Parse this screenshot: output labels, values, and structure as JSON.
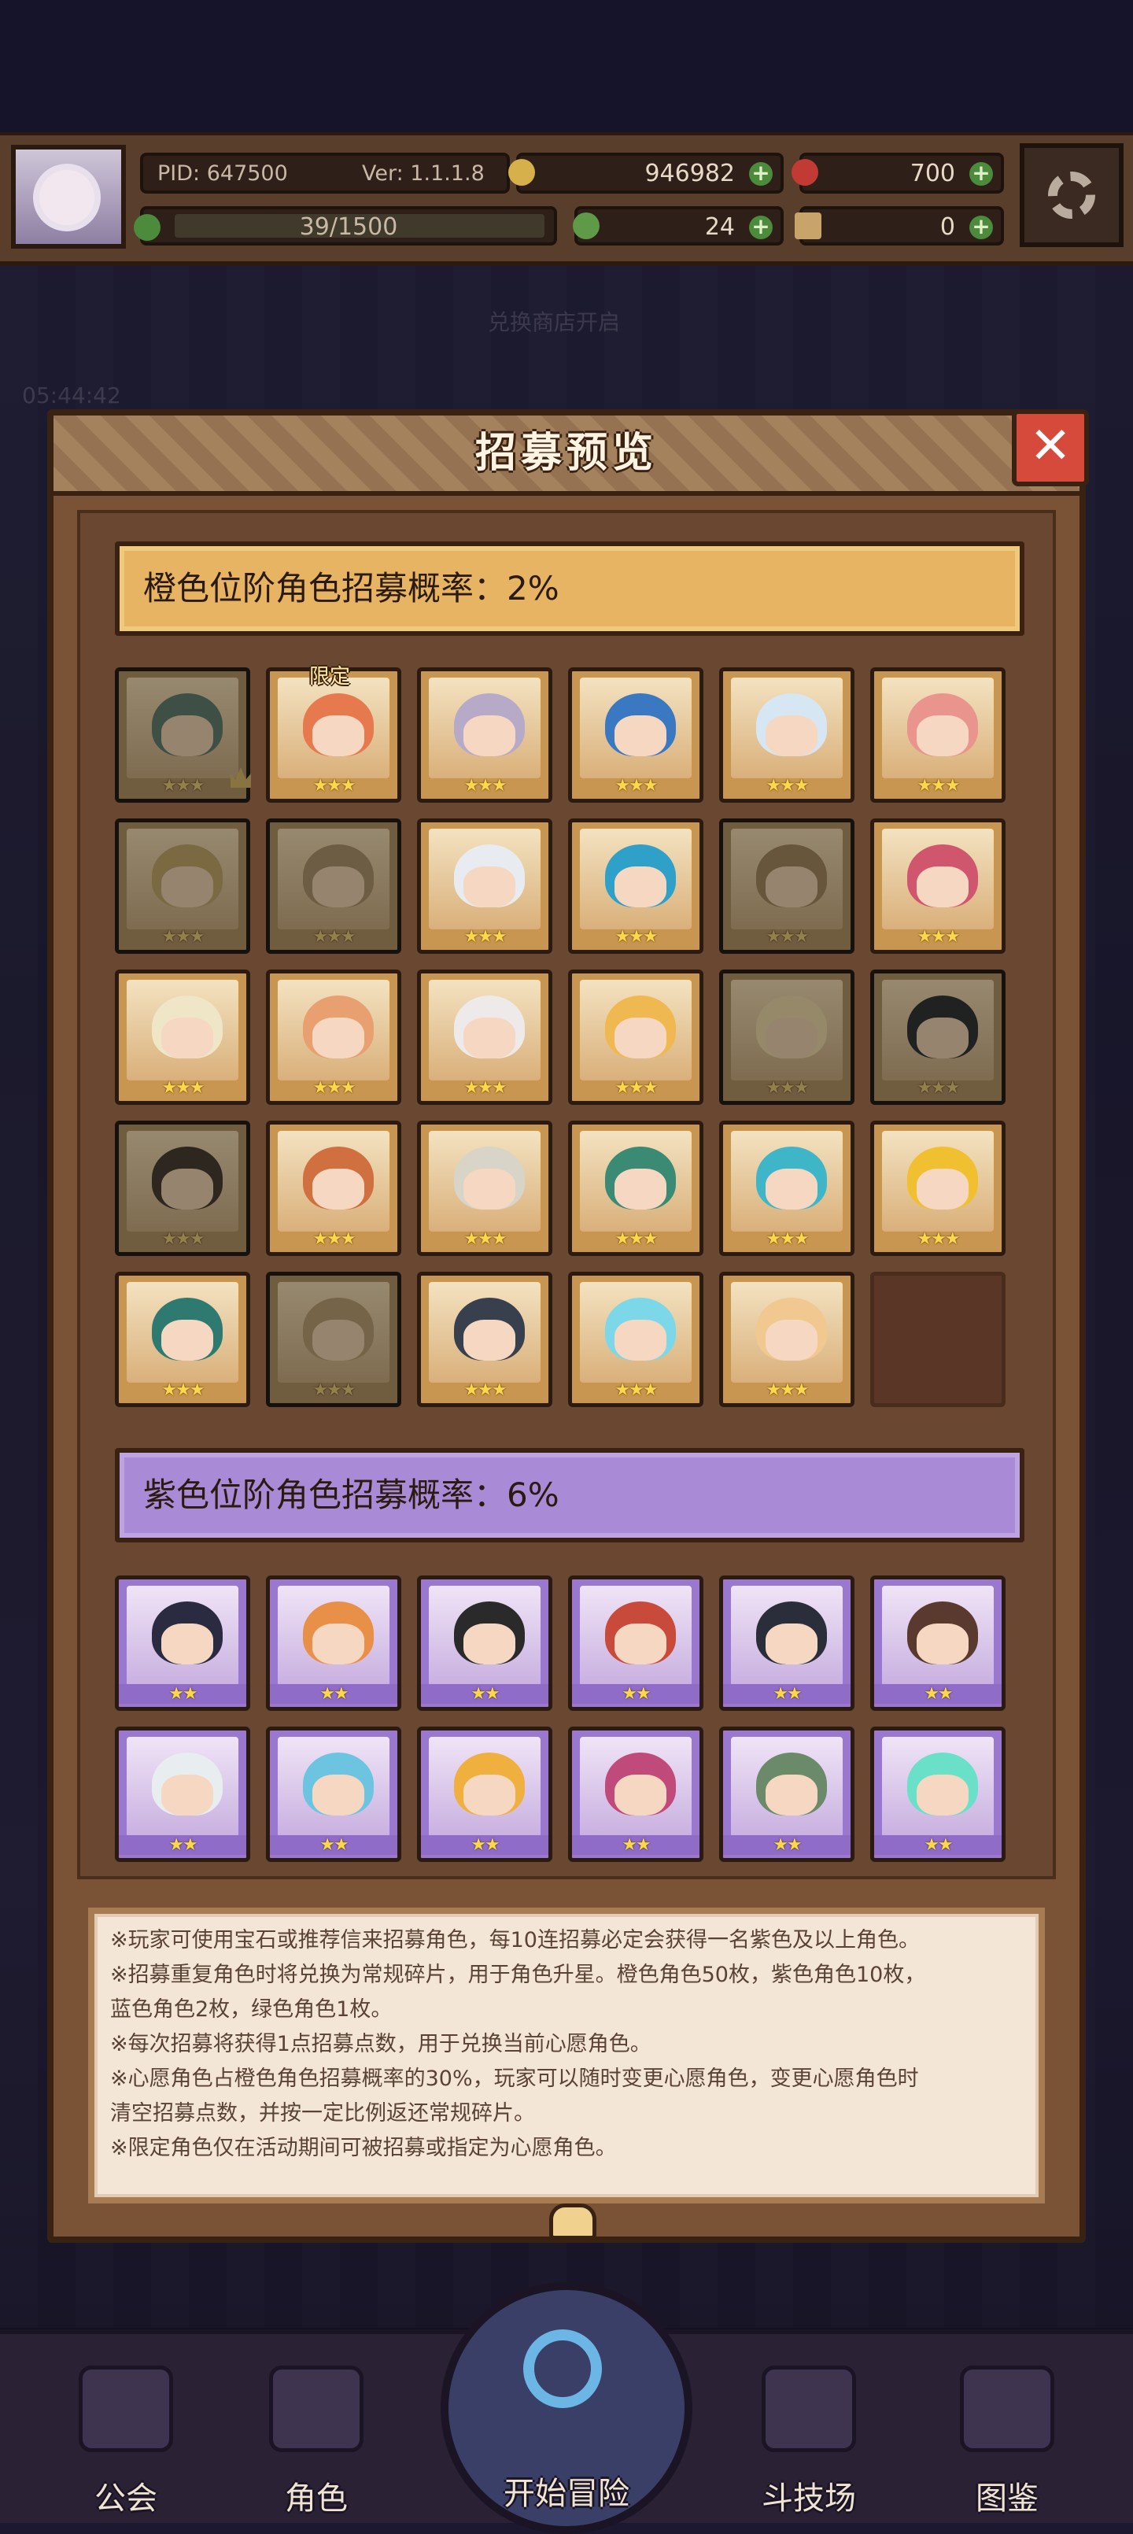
{
  "hud": {
    "pid": "PID: 647500",
    "version": "Ver: 1.1.1.8",
    "gold": "946982",
    "gems": "700",
    "exp": "39/1500",
    "clover": "24",
    "tickets": "0"
  },
  "background": {
    "timer": "05:44:42",
    "shop_label": "兑换商店开启"
  },
  "dialog": {
    "title": "招募预览",
    "orange_rate": "橙色位阶角色招募概率：2%",
    "purple_rate": "紫色位阶角色招募概率：6%",
    "limited_tag": "限定",
    "orange_stars": "★★★",
    "purple_stars": "★★",
    "notes": [
      "※玩家可使用宝石或推荐信来招募角色，每10连招募必定会获得一名紫色及以上角色。",
      "※招募重复角色时将兑换为常规碎片，用于角色升星。橙色角色50枚，紫色角色10枚，",
      "蓝色角色2枚，绿色角色1枚。",
      "※每次招募将获得1点招募点数，用于兑换当前心愿角色。",
      "※心愿角色占橙色角色招募概率的30%，玩家可以随时变更心愿角色，变更心愿角色时",
      "清空招募点数，并按一定比例返还常规碎片。",
      "※限定角色仅在活动期间可被招募或指定为心愿角色。"
    ]
  },
  "colors": {
    "orange_banner": "#e6b462",
    "purple_banner": "#a98ad6",
    "star": "#ffd84a",
    "close_button": "#d54a3a"
  },
  "nav": {
    "guild": "公会",
    "role": "角色",
    "adventure": "开始冒险",
    "arena": "斗技场",
    "atlas": "图鉴"
  }
}
